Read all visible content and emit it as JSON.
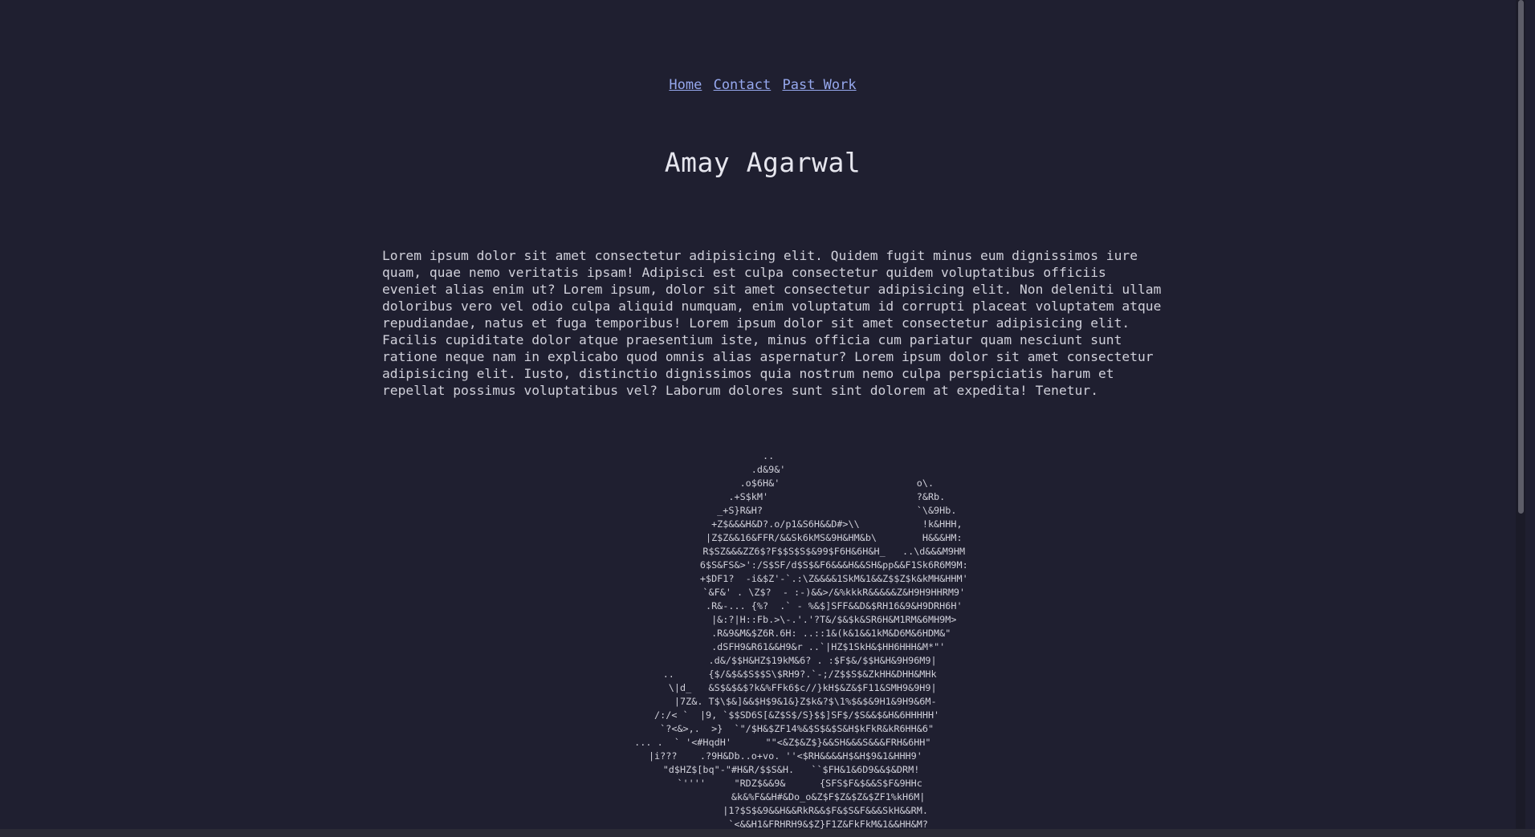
{
  "nav": {
    "home": "Home",
    "contact": "Contact",
    "past_work": "Past Work"
  },
  "title": "Amay Agarwal",
  "intro": "Lorem ipsum dolor sit amet consectetur adipisicing elit. Quidem fugit minus eum dignissimos iure\nquam, quae nemo veritatis ipsam! Adipisci est culpa consectetur quidem voluptatibus officiis\neveniet alias enim ut? Lorem ipsum, dolor sit amet consectetur adipisicing elit. Non deleniti ullam\ndoloribus vero vel odio culpa aliquid numquam, enim voluptatum id corrupti placeat voluptatem atque\nrepudiandae, natus et fuga temporibus! Lorem ipsum dolor sit amet consectetur adipisicing elit.\nFacilis cupiditate dolor atque praesentium iste, minus officia cum pariatur quam nesciunt sunt\nratione neque nam in explicabo quod omnis alias aspernatur? Lorem ipsum dolor sit amet consectetur\nadipisicing elit. Iusto, distinctio dignissimos quia nostrum nemo culpa perspiciatis harum et\nrepellat possimus voluptatibus vel? Laborum dolores sunt sint dolorem at expedita! Tenetur.",
  "ascii_art": [
    "                                   ..                                 ",
    "                                 .d&9&'                               ",
    "                               .o$6H&'                        o\\.     ",
    "                             .+S$kM'                          ?&Rb.   ",
    "                           _+S}R&H?                           `\\&9Hb. ",
    "                          +Z$&&&H&D?.o/p1&S6H&&D#>\\\\           !k&HHH,",
    "                         |Z$Z&&16&FFR/&&Sk6kMS&9H&HM&b\\        H&&&HM:",
    "                         R$SZ&&&ZZ6$?F$$S$S$&99$F6H&6H&H_   ..\\d&&&M9HM",
    "                         6$S&FS&>':/S$SF/d$S$&F6&&&H&&SH&pp&&F1Sk6R6M9M:",
    "                         +$DF1?  -i&$Z'-`.:\\Z&&&&1SkM&1&&Z$$Z$k&kMH&HHM'",
    "                         `&F&' . \\Z$?  - :-)&&>/&%kkkR&&&&&Z&H9H9HHRM9'",
    "                         .R&-... {%?  .` - %&$]SFF&&D&$RH16&9&H9DRH6H'",
    "                         |&:?|H::Fb.>\\-.'.'?T&/$&$k&SR6H&M1RM&6MH9M>",
    "                        .R&9&M&$Z6R.6H: ..::1&(k&1&&1kM&D6M&6HDM&\"",
    "                       .dSFH9&R61&&H9&r ..`|HZ$1SkH&$HH6HHH&M*\"'",
    "                     .d&/$$H&HZ$19kM&6? . :$F$&/$$H&H&9H96M9|",
    "             ..      {$/&$&$S$$S\\$RH9?.`-;/Z$$S$&ZkHH&DHH&MHk",
    "              \\|d_   &S$&$&$?k&%FFk6$c//}kH$&Z&$F11&SMH9&9H9|",
    "               |7Z&. T$\\$&]&&$H$9&1&}Z$k&?$\\1%$&$&9H1&9H9&6M-",
    "            /:/< `  |9, `$$SD6S[&Z$S$/S}$$]SF$/$S&&$&H&6HHHHH'",
    "            `?<&>,.  >}  `\"/$H&$ZF14%&$S$&$S&H$kFkR&kR6HH&6\"",
    "       ... .  ` '<#HqdH'      \"\"<&Z$&Z$}&&SH&&&S&&&FRH&6HH\"",
    "        |i???    .?9H&Db..o+vo. ''<$RH&&&&H$&H$9&1&HHH9'",
    "          \"d$HZ$[bq\"-\"#H&R/$$S&H.   ``$FH&1&6D9&&$&DRM!",
    "             `''''     \"RDZ$&&9&      {SFS$F&$&&S$F&9HHc",
    "                       &k&%F&&H#&Do_o&Z$F$Z&$Z&$ZF1%kH6M|",
    "                      |1?$S$&9&&H&&RkR&&$F&$S&F&&&SkH&&RM.",
    "                       `<&&H1&FRHRH9&$Z}F1Z&FkFkM&1&&HH&M?"
  ]
}
